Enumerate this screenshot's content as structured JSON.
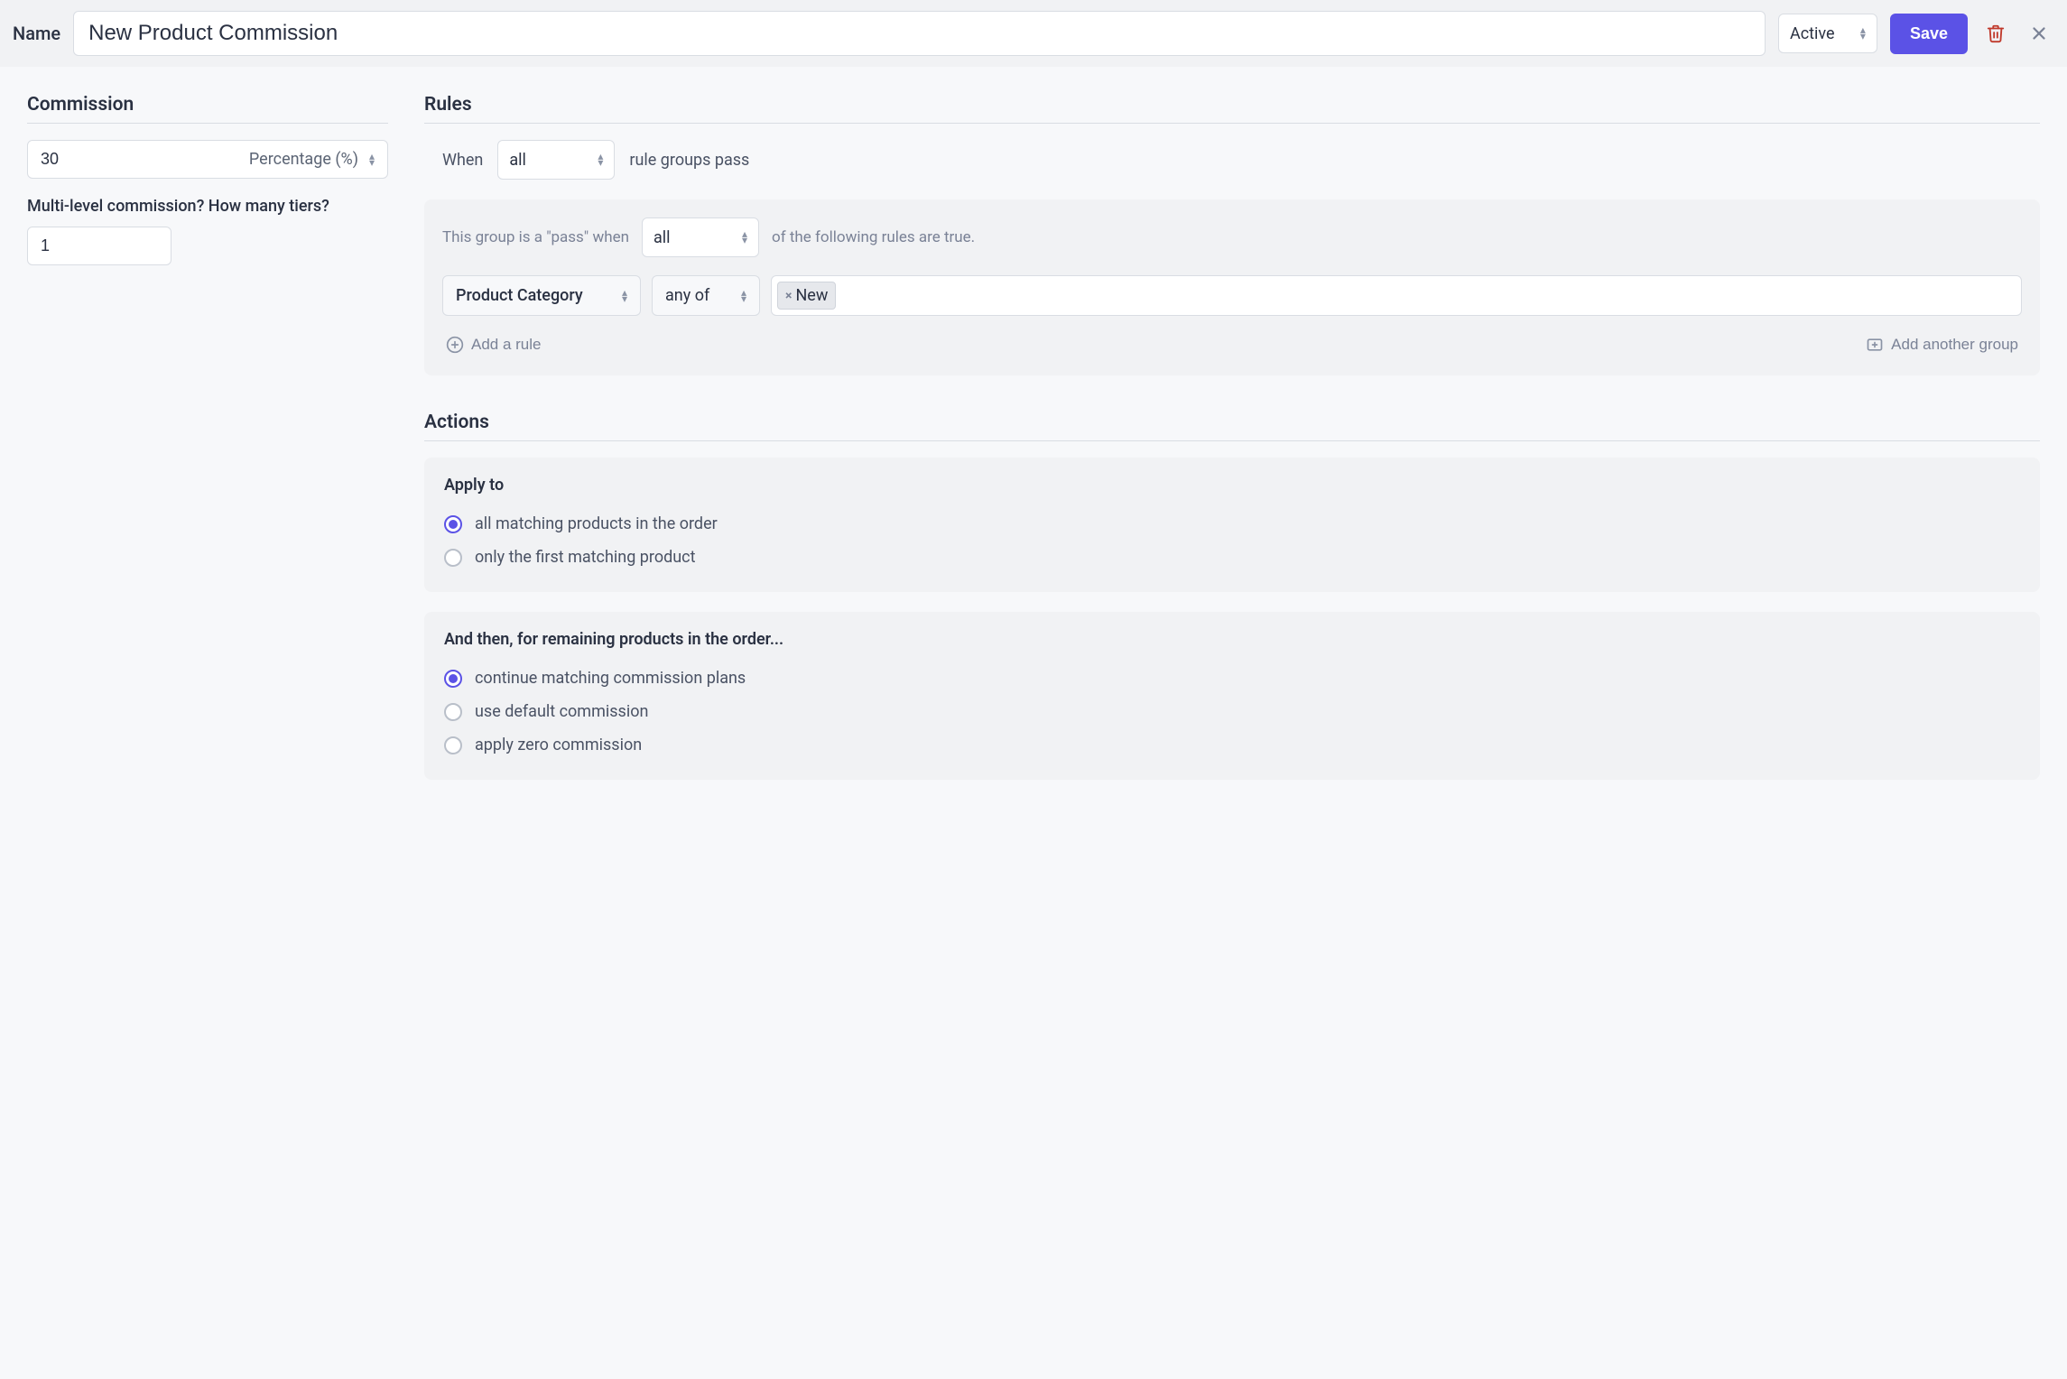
{
  "header": {
    "name_label": "Name",
    "name_value": "New Product Commission",
    "status_value": "Active",
    "save_label": "Save"
  },
  "commission": {
    "title": "Commission",
    "value": "30",
    "type_label": "Percentage (%)",
    "tiers_label": "Multi-level commission? How many tiers?",
    "tiers_value": "1"
  },
  "rules": {
    "title": "Rules",
    "when_label": "When",
    "when_value": "all",
    "when_suffix": "rule groups pass",
    "group": {
      "prefix": "This group is a \"pass\" when",
      "match_value": "all",
      "suffix": "of the following rules are true.",
      "rule": {
        "field": "Product Category",
        "operator": "any of",
        "tag": "New"
      },
      "add_rule_label": "Add a rule",
      "add_group_label": "Add another group"
    }
  },
  "actions": {
    "title": "Actions",
    "apply": {
      "title": "Apply to",
      "opt_all": "all matching products in the order",
      "opt_first": "only the first matching product"
    },
    "then": {
      "title": "And then, for remaining products in the order...",
      "opt_continue": "continue matching commission plans",
      "opt_default": "use default commission",
      "opt_zero": "apply zero commission"
    }
  }
}
